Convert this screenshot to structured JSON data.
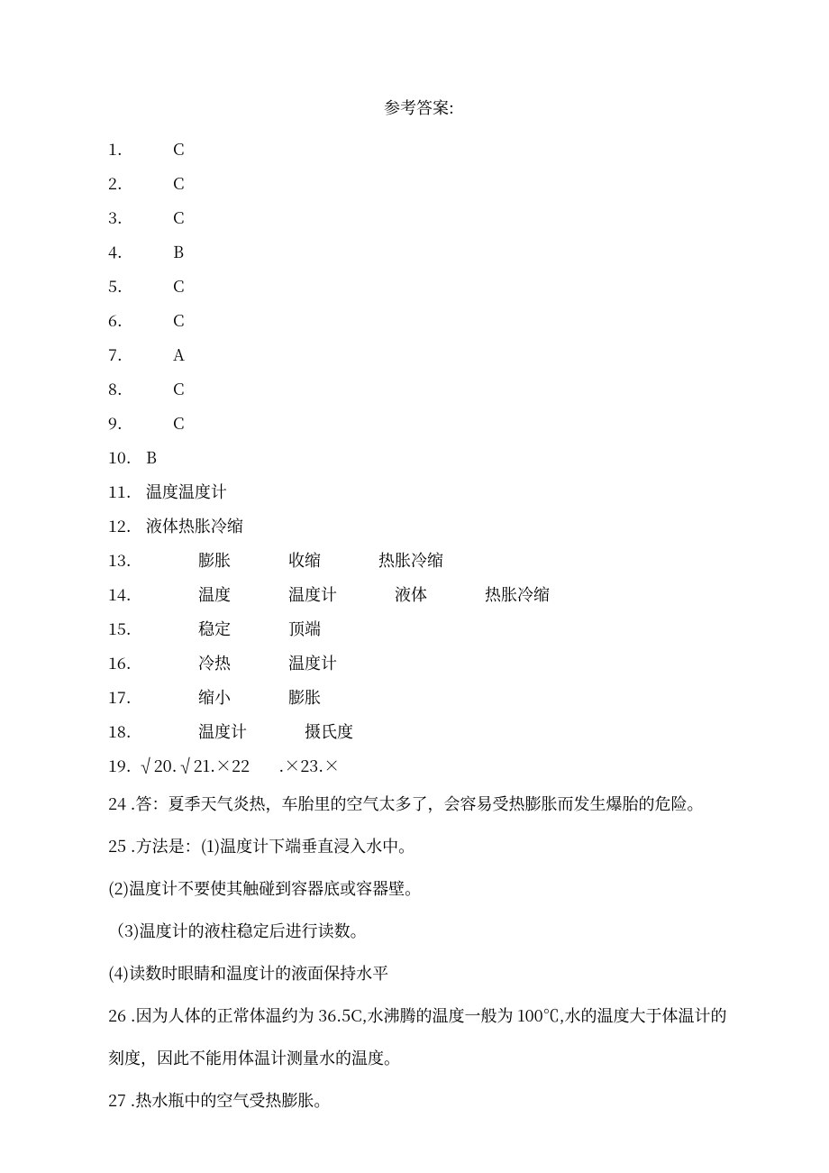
{
  "title": "参考答案:",
  "items": [
    {
      "n": "1.",
      "type": "single",
      "v": "C"
    },
    {
      "n": "2.",
      "type": "single",
      "v": "C"
    },
    {
      "n": "3.",
      "type": "single",
      "v": "C"
    },
    {
      "n": "4.",
      "type": "single",
      "v": "B"
    },
    {
      "n": "5.",
      "type": "single",
      "v": "C"
    },
    {
      "n": "6.",
      "type": "single",
      "v": "C"
    },
    {
      "n": "7.",
      "type": "single",
      "v": "A"
    },
    {
      "n": "8.",
      "type": "single",
      "v": "C"
    },
    {
      "n": "9.",
      "type": "single",
      "v": "C"
    },
    {
      "n": "10.",
      "type": "single_tight",
      "v": "B"
    },
    {
      "n": "11.",
      "type": "single_tight",
      "v": "温度温度计"
    },
    {
      "n": "12.",
      "type": "single_tight",
      "v": "液体热胀冷缩"
    },
    {
      "n": "13.",
      "type": "multi",
      "parts": [
        "膨胀",
        "收缩",
        "热胀冷缩"
      ]
    },
    {
      "n": "14.",
      "type": "multi",
      "parts": [
        "温度",
        "温度计",
        "液体",
        "热胀冷缩"
      ]
    },
    {
      "n": "15.",
      "type": "multi",
      "parts": [
        "稳定",
        "顶端"
      ]
    },
    {
      "n": "16.",
      "type": "multi",
      "parts": [
        "冷热",
        "温度计"
      ]
    },
    {
      "n": "17.",
      "type": "multi",
      "parts": [
        "缩小",
        "膨胀"
      ]
    },
    {
      "n": "18.",
      "type": "multi",
      "parts": [
        "温度计",
        "摄氏度"
      ]
    }
  ],
  "line19": {
    "n": "19.",
    "text": "√20.√21.×22       .×23.×"
  },
  "q24": {
    "n": "24",
    "text": ".答：夏季天气炎热，车胎里的空气太多了，会容易受热膨胀而发生爆胎的危险。"
  },
  "q25": {
    "n": "25",
    "lead": ".方法是：(1)温度计下端垂直浸入水中。",
    "s2": "(2)温度计不要使其触碰到容器底或容器壁。",
    "s3": "（3)温度计的液柱稳定后进行读数。",
    "s4": "(4)读数时眼睛和温度计的液面保持水平"
  },
  "q26": {
    "n": "26",
    "l1": ".因为人体的正常体温约为 36.5C,水沸腾的温度一般为 100℃,水的温度大于体温计的",
    "l2": "刻度，因此不能用体温计测量水的温度。"
  },
  "q27": {
    "n": "27",
    "text": ".热水瓶中的空气受热膨胀。"
  }
}
